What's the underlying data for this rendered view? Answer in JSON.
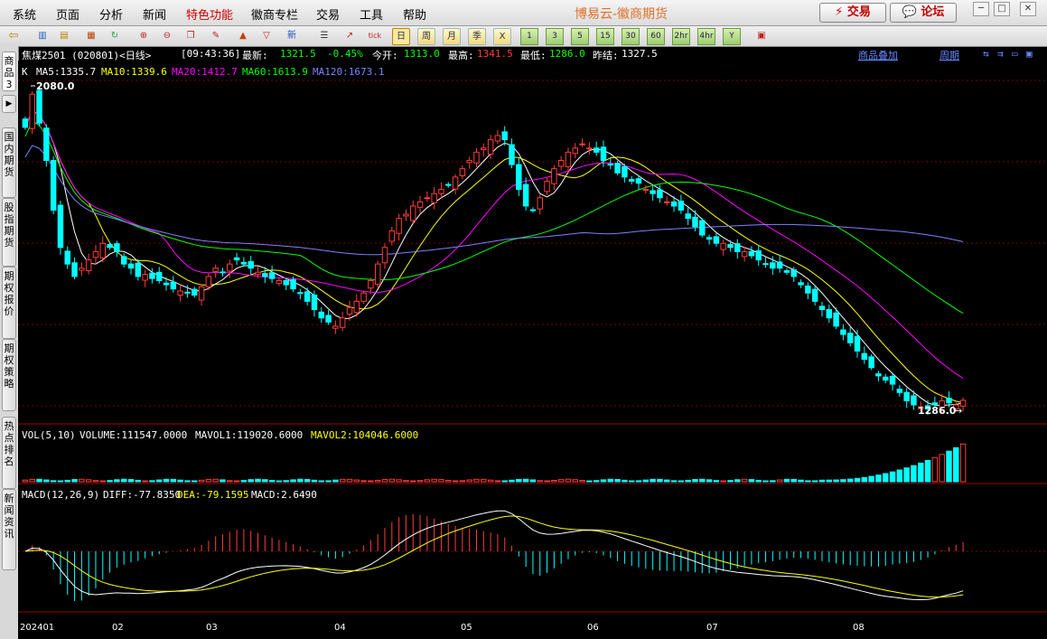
{
  "menu": {
    "items": [
      "系统",
      "页面",
      "分析",
      "新闻",
      "特色功能",
      "徽商专栏",
      "交易",
      "工具",
      "帮助"
    ],
    "highlight_index": 4,
    "app_title": "博易云-徽商期货",
    "trade_button": "交易",
    "forum_button": "论坛"
  },
  "toolbar": {
    "period_buttons": [
      "日",
      "周",
      "月",
      "季",
      "X",
      "1",
      "3",
      "5",
      "15",
      "30",
      "60",
      "2hr",
      "4hr",
      "Y"
    ],
    "selected_period": "日"
  },
  "sidebar": {
    "tabs": [
      "商品3",
      "国内期货",
      "股指期货",
      "期权报价",
      "期权策略",
      "热点排名",
      "新闻资讯"
    ]
  },
  "quote": {
    "symbol": "焦煤2501 (020801)<日线>",
    "time": "[09:43:36]",
    "latest_label": "最新:",
    "latest": "1321.5",
    "change": "-0.45%",
    "open_label": "今开:",
    "open": "1313.0",
    "high_label": "最高:",
    "high": "1341.5",
    "low_label": "最低:",
    "low": "1286.0",
    "prev_label": "昨结:",
    "prev": "1327.5",
    "overlay_link": "商品叠加",
    "period_link": "周期"
  },
  "colors": {
    "up": "#ff3b3b",
    "down": "#00ffff",
    "ma5": "#ffffff",
    "ma10": "#ffff00",
    "ma20": "#ff00ff",
    "ma60": "#00ff00",
    "ma120": "#8080ff",
    "grid": "#7a0000"
  },
  "price_panel": {
    "indicator_label": "K",
    "ma5": "MA5:1335.7",
    "ma10": "MA10:1339.6",
    "ma20": "MA20:1412.7",
    "ma60": "MA60:1613.9",
    "ma120": "MA120:1673.1",
    "high_marker": "2080.0",
    "low_marker": "1286.0"
  },
  "volume_panel": {
    "label": "VOL(5,10)",
    "volume": "VOLUME:111547.0000",
    "mavol1": "MAVOL1:119020.6000",
    "mavol2": "MAVOL2:104046.6000"
  },
  "macd_panel": {
    "label": "MACD(12,26,9)",
    "diff": "DIFF:-77.8350",
    "dea": "DEA:-79.1595",
    "macd": "MACD:2.6490"
  },
  "x_axis": {
    "labels": [
      "202401",
      "02",
      "03",
      "04",
      "05",
      "06",
      "07",
      "08"
    ]
  },
  "chart_data": {
    "type": "candlestick",
    "price_range": [
      1286,
      2080
    ],
    "close_series": [
      1980,
      2060,
      1990,
      1900,
      1780,
      1690,
      1650,
      1620,
      1640,
      1660,
      1680,
      1700,
      1690,
      1680,
      1650,
      1640,
      1620,
      1625,
      1615,
      1610,
      1600,
      1590,
      1585,
      1580,
      1575,
      1595,
      1620,
      1640,
      1630,
      1650,
      1660,
      1650,
      1640,
      1630,
      1620,
      1615,
      1610,
      1600,
      1590,
      1580,
      1560,
      1540,
      1520,
      1510,
      1500,
      1520,
      1545,
      1560,
      1580,
      1610,
      1650,
      1690,
      1730,
      1760,
      1770,
      1790,
      1800,
      1810,
      1820,
      1830,
      1840,
      1860,
      1880,
      1900,
      1920,
      1930,
      1950,
      1960,
      1950,
      1890,
      1830,
      1790,
      1780,
      1810,
      1850,
      1880,
      1900,
      1920,
      1930,
      1940,
      1930,
      1920,
      1900,
      1890,
      1870,
      1860,
      1850,
      1845,
      1830,
      1820,
      1810,
      1800,
      1790,
      1780,
      1760,
      1740,
      1720,
      1710,
      1700,
      1700,
      1690,
      1680,
      1680,
      1670,
      1660,
      1650,
      1640,
      1640,
      1630,
      1620,
      1600,
      1580,
      1560,
      1540,
      1520,
      1500,
      1480,
      1460,
      1440,
      1420,
      1400,
      1380,
      1370,
      1360,
      1340,
      1320,
      1310,
      1305,
      1300,
      1310,
      1320,
      1315,
      1310,
      1321
    ],
    "volume_last": 111547,
    "macd": {
      "diff": -77.835,
      "dea": -79.1595,
      "macd": 2.649
    }
  }
}
